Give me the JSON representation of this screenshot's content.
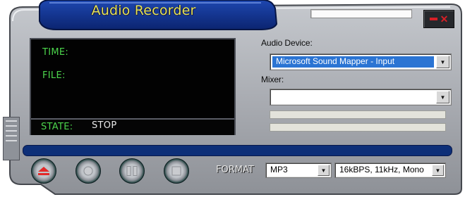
{
  "app": {
    "title": "Audio Recorder"
  },
  "window": {
    "minimize_icon": "minimize-icon",
    "close_icon": "close-icon",
    "close_glyph": "✕"
  },
  "screen": {
    "time_label": "TIME:",
    "file_label": "FILE:",
    "state_label": "STATE:",
    "state_value": "STOP"
  },
  "audio_device": {
    "label": "Audio Device:",
    "selected": "Microsoft Sound Mapper - Input"
  },
  "mixer": {
    "label": "Mixer:",
    "selected": ""
  },
  "transport": {
    "buttons": [
      {
        "name": "eject-button",
        "icon": "eject-icon"
      },
      {
        "name": "record-button",
        "icon": "record-icon"
      },
      {
        "name": "pause-button",
        "icon": "pause-icon"
      },
      {
        "name": "stop-button",
        "icon": "stop-icon"
      }
    ]
  },
  "format": {
    "label": "FORMAT",
    "type": "MP3",
    "quality": "16kBPS, 11kHz, Mono"
  },
  "dropdown_glyph": "▼",
  "colors": {
    "title_text": "#e4e35a",
    "screen_label": "#4cd54c",
    "selection": "#2b74d3",
    "skin_blue": "#0e2f86",
    "eject_red": "#e22a2a"
  }
}
